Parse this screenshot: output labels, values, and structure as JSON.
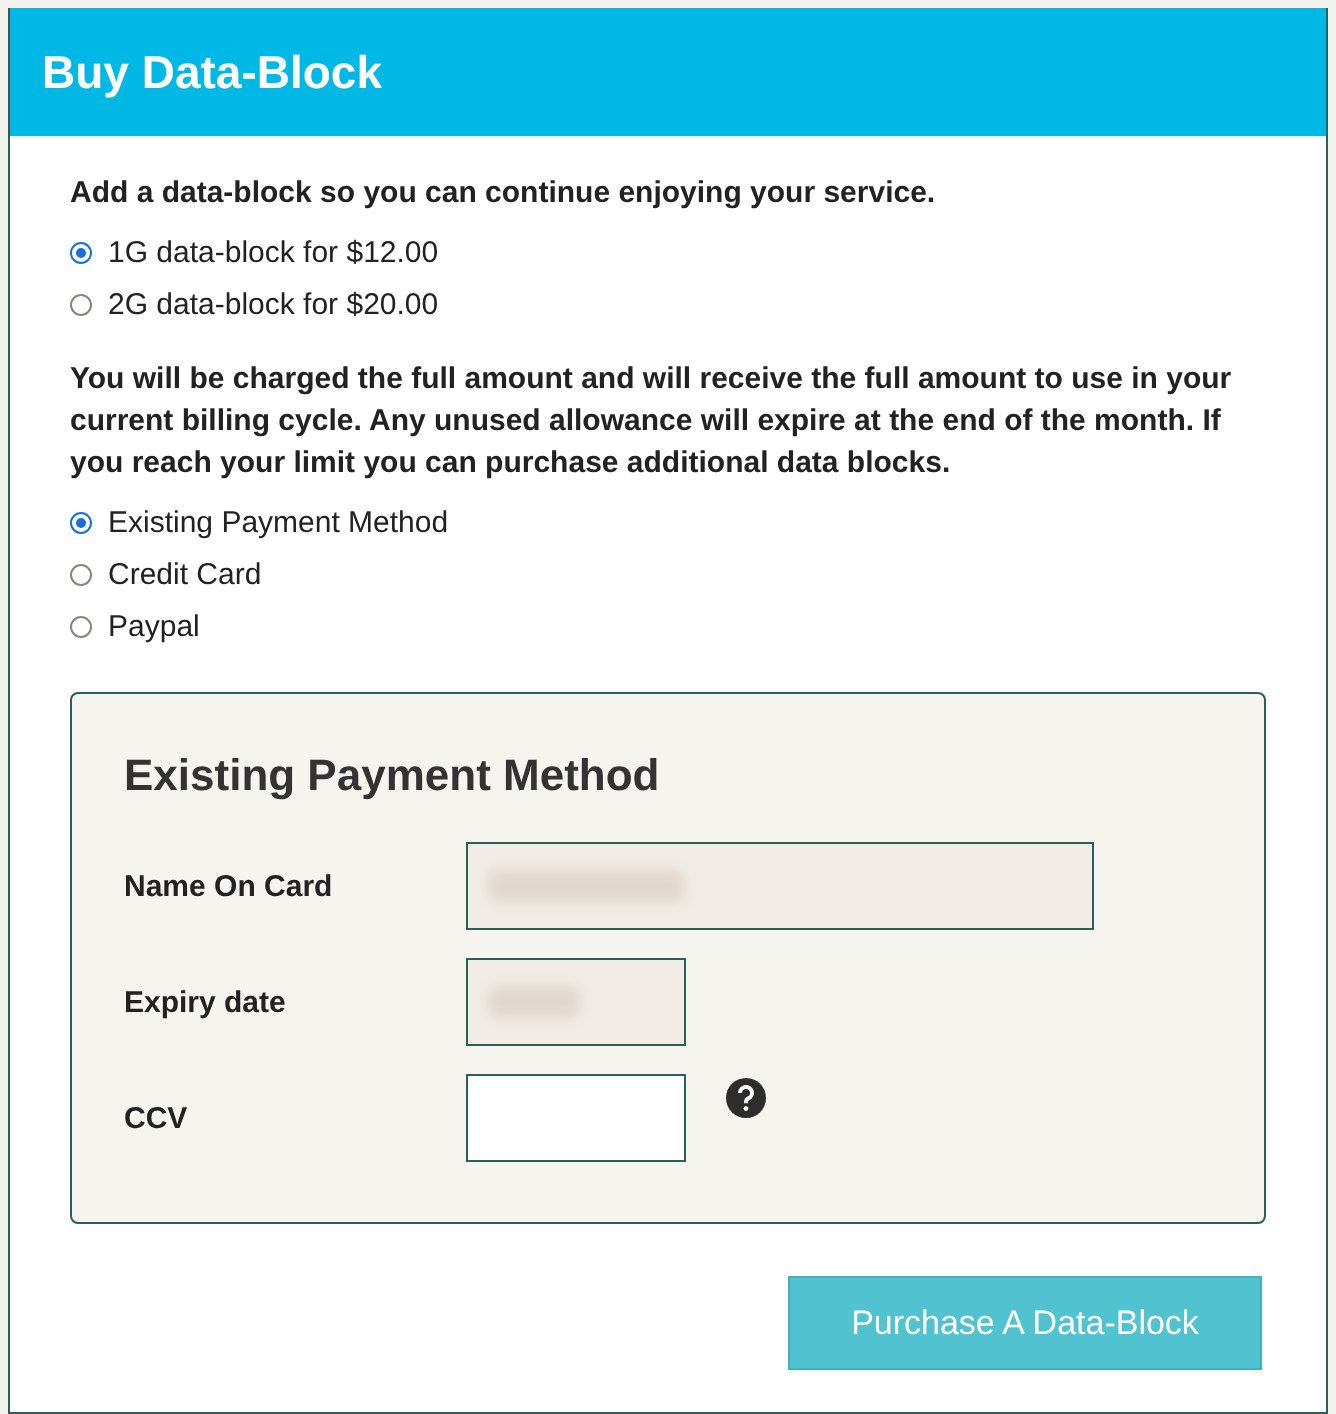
{
  "window": {
    "title": "Buy Data-Block"
  },
  "intro": "Add a data-block so you can continue enjoying your service.",
  "blocks": [
    {
      "label": "1G data-block for $12.00",
      "selected": true
    },
    {
      "label": "2G data-block for $20.00",
      "selected": false
    }
  ],
  "notice": "You will be charged the full amount and will receive the full amount to use in your current billing cycle. Any unused allowance will expire at the end of the month. If you reach your limit you can purchase additional data blocks.",
  "payment_methods": [
    {
      "label": "Existing Payment Method",
      "selected": true
    },
    {
      "label": "Credit Card",
      "selected": false
    },
    {
      "label": "Paypal",
      "selected": false
    }
  ],
  "panel": {
    "title": "Existing Payment Method",
    "fields": [
      {
        "label": "Name On Card",
        "kind": "wide",
        "redacted": true,
        "help": false
      },
      {
        "label": "Expiry date",
        "kind": "narrow",
        "redacted": true,
        "help": false
      },
      {
        "label": "CCV",
        "kind": "narrow",
        "redacted": false,
        "help": true
      }
    ]
  },
  "button": "Purchase A Data-Block"
}
